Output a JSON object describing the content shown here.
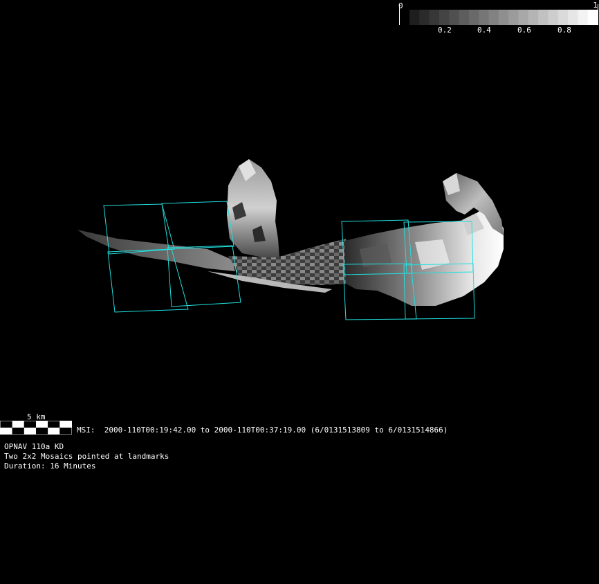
{
  "colorbar": {
    "min_label": "0",
    "max_label": "1",
    "tick_labels": [
      "0.2",
      "0.4",
      "0.6",
      "0.8"
    ],
    "gradient_from": "#000000",
    "gradient_to": "#ffffff"
  },
  "scale_bar": {
    "label": "5 km"
  },
  "msi_line": "MSI:  2000-110T00:19:42.00 to 2000-110T00:37:19.00 (6/0131513809 to 6/0131514866)",
  "info": {
    "title": "OPNAV 110a KD",
    "description": "Two 2x2 Mosaics pointed at landmarks",
    "duration": "Duration: 16 Minutes"
  },
  "colors": {
    "background": "#000000",
    "footprint_outline": "#22e0e0"
  }
}
